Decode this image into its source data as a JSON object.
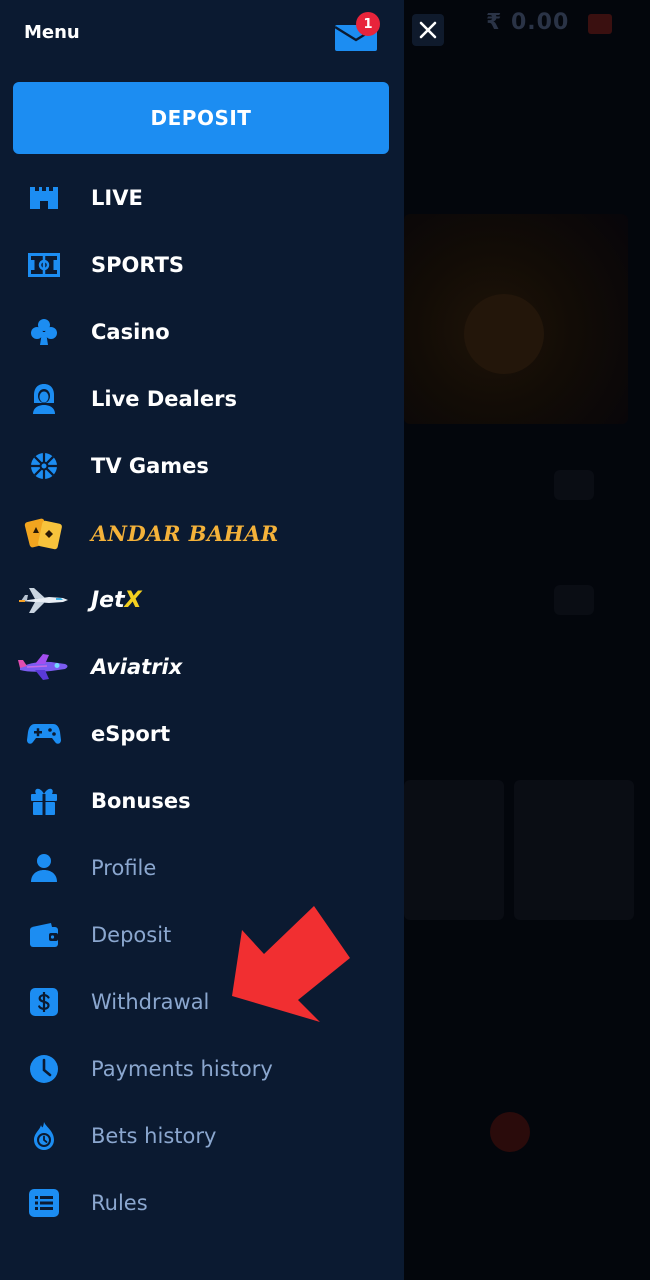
{
  "header": {
    "menu_title": "Menu",
    "notification_count": "1",
    "mail_icon": "mail-icon",
    "close_icon": "close-icon"
  },
  "deposit_button": {
    "label": "DEPOSIT"
  },
  "menu": {
    "items": [
      {
        "label": "LIVE",
        "icon": "castle-icon",
        "style": "bold"
      },
      {
        "label": "SPORTS",
        "icon": "football-field-icon",
        "style": "bold"
      },
      {
        "label": "Casino",
        "icon": "club-suit-icon",
        "style": "bold"
      },
      {
        "label": "Live Dealers",
        "icon": "dealer-icon",
        "style": "bold"
      },
      {
        "label": "TV Games",
        "icon": "wheel-icon",
        "style": "bold"
      },
      {
        "label": "ANDAR BAHAR",
        "icon": "cards-icon",
        "style": "andar"
      },
      {
        "label": "JetX",
        "label_main": "Jet",
        "label_x": "X",
        "icon": "jet-plane-icon",
        "style": "jetx"
      },
      {
        "label": "Aviatrix",
        "icon": "airplane-icon",
        "style": "aviatrix"
      },
      {
        "label": "eSport",
        "icon": "gamepad-icon",
        "style": "bold"
      },
      {
        "label": "Bonuses",
        "icon": "gift-icon",
        "style": "bold"
      },
      {
        "label": "Profile",
        "icon": "user-icon",
        "style": "light"
      },
      {
        "label": "Deposit",
        "icon": "wallet-icon",
        "style": "light"
      },
      {
        "label": "Withdrawal",
        "icon": "dollar-icon",
        "style": "light"
      },
      {
        "label": "Payments history",
        "icon": "clock-icon",
        "style": "light"
      },
      {
        "label": "Bets history",
        "icon": "bets-history-icon",
        "style": "light"
      },
      {
        "label": "Rules",
        "icon": "list-icon",
        "style": "light"
      }
    ]
  },
  "background": {
    "balance": "₹ 0.00"
  },
  "colors": {
    "menu_bg": "#0b1a31",
    "accent": "#1c8df2",
    "badge": "#e8243b",
    "muted_text": "#8ba7cf",
    "arrow": "#f12f31"
  }
}
